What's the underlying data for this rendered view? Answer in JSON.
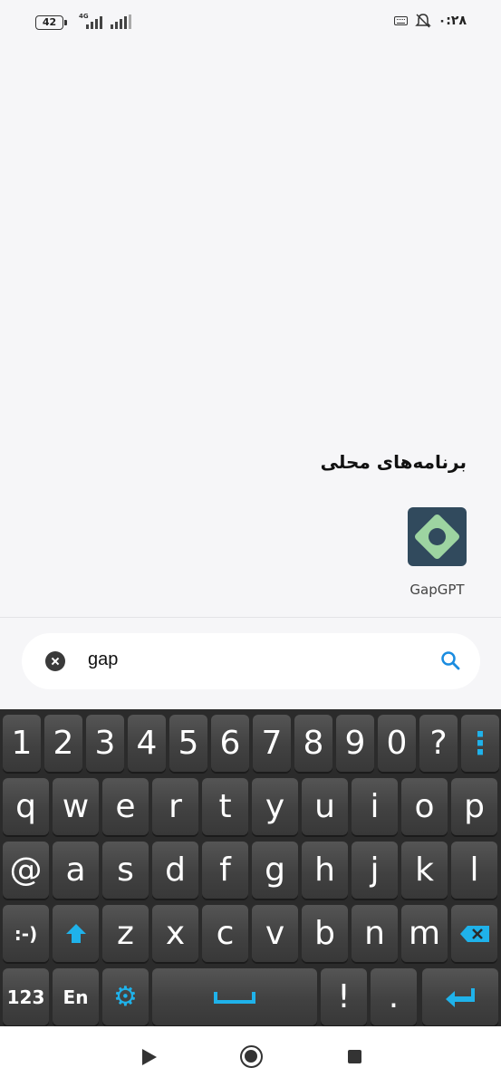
{
  "status_bar": {
    "time": "۰:۲۸",
    "battery": "42",
    "network_label": "4G",
    "icons": [
      "keyboard-icon",
      "silent-bell-icon",
      "signal-icon",
      "battery-icon"
    ]
  },
  "section": {
    "title": "برنامه‌های محلی"
  },
  "apps": [
    {
      "label": "GapGPT",
      "icon": "gapgpt-app-icon",
      "icon_color": "#314a5d",
      "accent": "#9dd4a1"
    }
  ],
  "search": {
    "value": "gap",
    "clear_icon": "clear-icon",
    "search_icon": "search-icon"
  },
  "keyboard": {
    "row1": [
      "1",
      "2",
      "3",
      "4",
      "5",
      "6",
      "7",
      "8",
      "9",
      "0",
      "?",
      "⋮"
    ],
    "row2": [
      "q",
      "w",
      "e",
      "r",
      "t",
      "y",
      "u",
      "i",
      "o",
      "p"
    ],
    "row3": [
      "@",
      "a",
      "s",
      "d",
      "f",
      "g",
      "h",
      "j",
      "k",
      "l"
    ],
    "row4": [
      ":-)",
      "⇧",
      "z",
      "x",
      "c",
      "v",
      "b",
      "n",
      "m",
      "⌫"
    ],
    "row5": [
      "123",
      "En",
      "⚙",
      "␣",
      "!",
      ".",
      "↵"
    ],
    "accent_color": "#1fb2ea"
  },
  "nav_bar": {
    "icons": [
      "back-icon",
      "home-icon",
      "recents-icon"
    ]
  }
}
